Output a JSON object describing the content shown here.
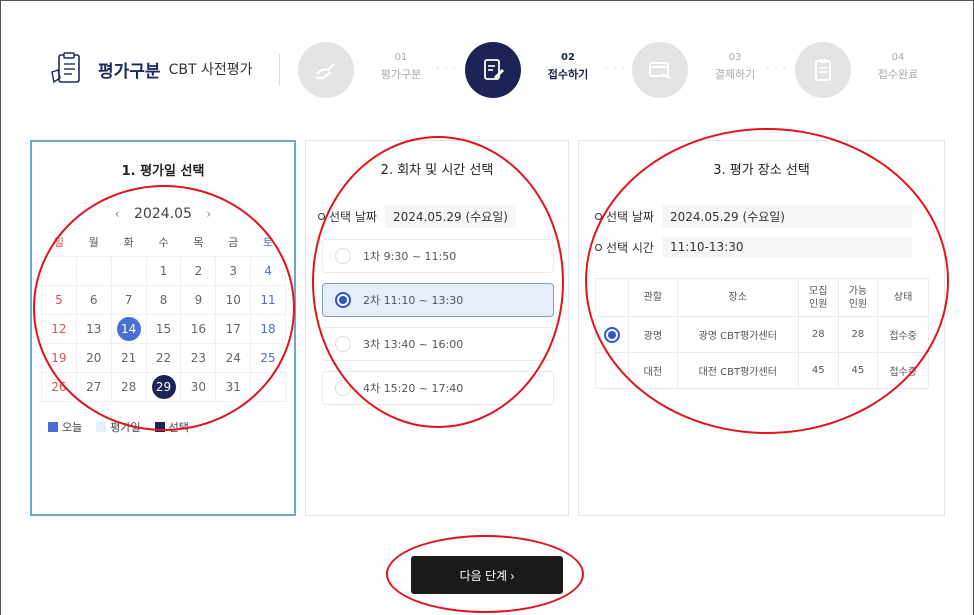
{
  "header": {
    "title": "평가구분",
    "subtitle": "CBT 사전평가",
    "steps": [
      {
        "num": "01",
        "label": "평가구분",
        "active": false,
        "icon": "hand-pen-icon"
      },
      {
        "num": "02",
        "label": "접수하기",
        "active": true,
        "icon": "edit-document-icon"
      },
      {
        "num": "03",
        "label": "결제하기",
        "active": false,
        "icon": "payment-card-icon"
      },
      {
        "num": "04",
        "label": "접수완료",
        "active": false,
        "icon": "clipboard-icon"
      }
    ],
    "dots": "· · ·"
  },
  "panel_date": {
    "title": "1. 평가일 선택",
    "month": "2024.05",
    "prev": "‹",
    "next": "›",
    "weekdays": [
      "일",
      "월",
      "화",
      "수",
      "목",
      "금",
      "토"
    ],
    "weeks": [
      [
        "",
        "",
        "",
        "1",
        "2",
        "3",
        "4"
      ],
      [
        "5",
        "6",
        "7",
        "8",
        "9",
        "10",
        "11"
      ],
      [
        "12",
        "13",
        "14",
        "15",
        "16",
        "17",
        "18"
      ],
      [
        "19",
        "20",
        "21",
        "22",
        "23",
        "24",
        "25"
      ],
      [
        "26",
        "27",
        "28",
        "29",
        "30",
        "31",
        ""
      ]
    ],
    "today": "14",
    "selected": "29",
    "legend": {
      "today": "오늘",
      "eval_day": "평가일",
      "selected": "선택"
    },
    "colors": {
      "today": "#4a6fd0",
      "eval_day": "#e8edf8",
      "selected": "#1c2455"
    }
  },
  "panel_session": {
    "title": "2. 회차 및 시간 선택",
    "date_label": "선택 날짜",
    "date_value": "2024.05.29 (수요일)",
    "sessions": [
      {
        "label": "1차 9:30 ~ 11:50",
        "selected": false
      },
      {
        "label": "2차 11:10 ~ 13:30",
        "selected": true
      },
      {
        "label": "3차 13:40 ~ 16:00",
        "selected": false
      },
      {
        "label": "4차 15:20 ~ 17:40",
        "selected": false
      }
    ]
  },
  "panel_venue": {
    "title": "3. 평가 장소 선택",
    "date_label": "선택 날짜",
    "date_value": "2024.05.29 (수요일)",
    "time_label": "선택 시간",
    "time_value": "11:10-13:30",
    "columns": [
      "",
      "관할",
      "장소",
      "모집\n인원",
      "가능\n인원",
      "상태"
    ],
    "rows": [
      {
        "selected": true,
        "region": "광명",
        "place": "광명 CBT평가센터",
        "capacity": "28",
        "available": "28",
        "status": "접수중"
      },
      {
        "selected": false,
        "region": "대전",
        "place": "대전 CBT평가센터",
        "capacity": "45",
        "available": "45",
        "status": "접수중"
      }
    ]
  },
  "next_button": "다음 단계 ›"
}
